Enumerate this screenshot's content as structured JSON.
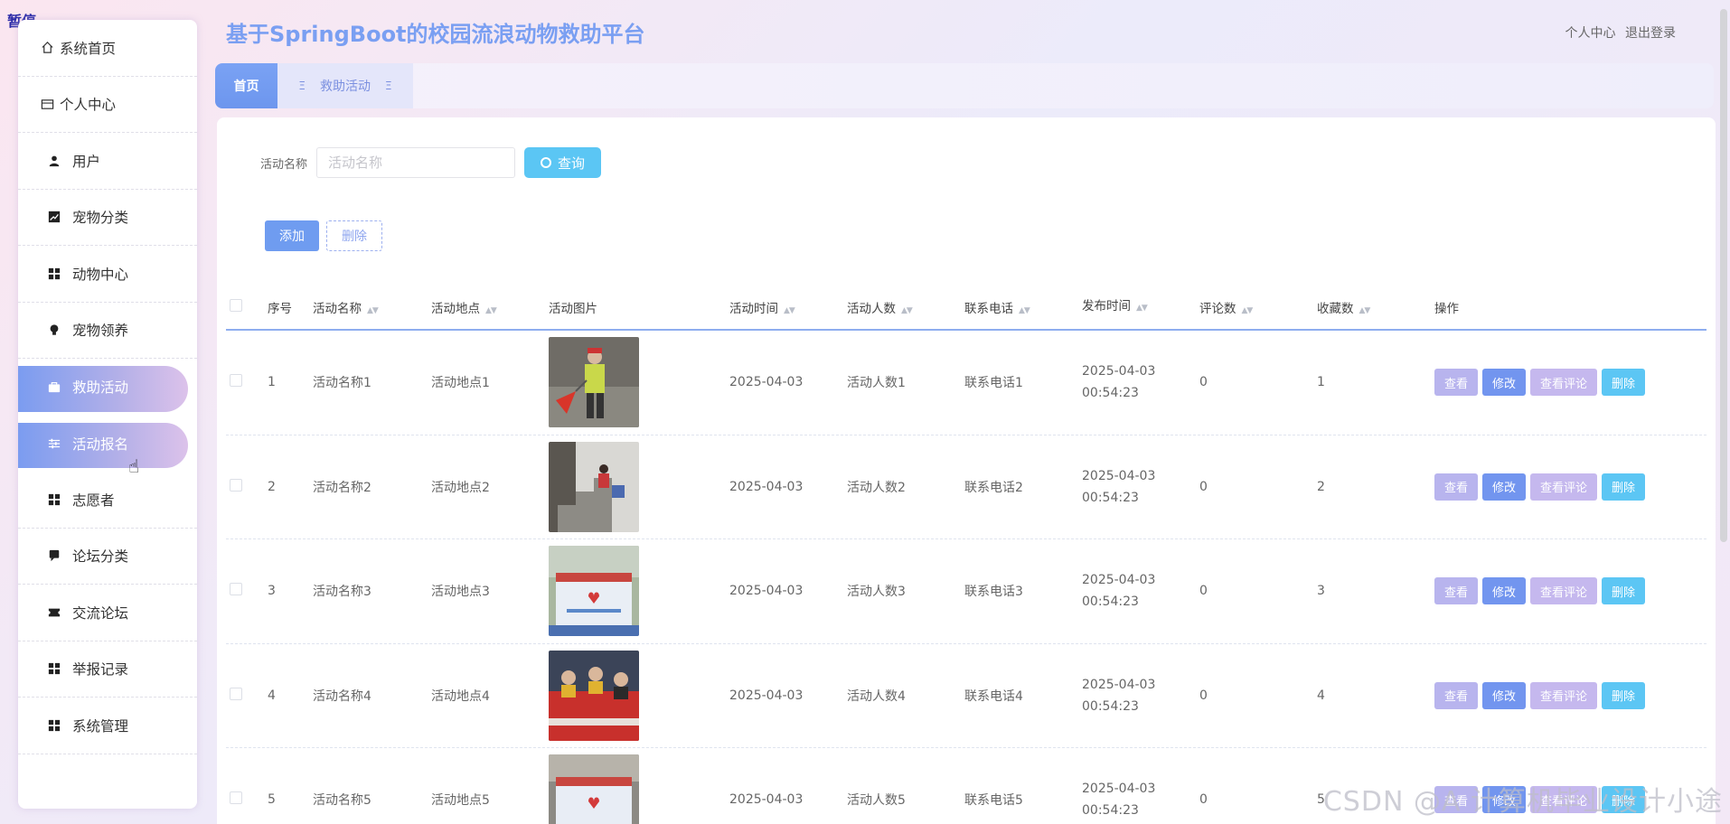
{
  "overlay": {
    "pause_tag": "暂停"
  },
  "header": {
    "title": "基于SpringBoot的校园流浪动物救助平台",
    "links": [
      "个人中心",
      "退出登录"
    ]
  },
  "sidebar": {
    "items": [
      {
        "label": "系统首页",
        "icon": "home-icon"
      },
      {
        "label": "个人中心",
        "icon": "card-icon"
      },
      {
        "label": "用户",
        "icon": "user-icon"
      },
      {
        "label": "宠物分类",
        "icon": "chart-icon"
      },
      {
        "label": "动物中心",
        "icon": "grid-icon"
      },
      {
        "label": "宠物领养",
        "icon": "bulb-icon"
      },
      {
        "label": "救助活动",
        "icon": "bag-icon",
        "active": true
      },
      {
        "label": "活动报名",
        "icon": "sliders-icon",
        "active": true
      },
      {
        "label": "志愿者",
        "icon": "grid-icon"
      },
      {
        "label": "论坛分类",
        "icon": "chat-icon"
      },
      {
        "label": "交流论坛",
        "icon": "ticket-icon"
      },
      {
        "label": "举报记录",
        "icon": "grid-icon"
      },
      {
        "label": "系统管理",
        "icon": "grid-icon"
      }
    ]
  },
  "tabs": {
    "home": "首页",
    "rescue": "救助活动",
    "separator": "Ξ"
  },
  "search": {
    "label": "活动名称",
    "placeholder": "活动名称",
    "button": "查询"
  },
  "actions": {
    "add": "添加",
    "delete": "删除"
  },
  "table": {
    "headers": [
      "序号",
      "活动名称",
      "活动地点",
      "活动图片",
      "活动时间",
      "活动人数",
      "联系电话",
      "发布时间",
      "评论数",
      "收藏数",
      "操作"
    ],
    "ops": {
      "view": "查看",
      "edit": "修改",
      "comments": "查看评论",
      "delete": "删除"
    },
    "rows": [
      {
        "idx": "1",
        "name": "活动名称1",
        "location": "活动地点1",
        "time": "2025-04-03",
        "people": "活动人数1",
        "phone": "联系电话1",
        "published": "2025-04-03 00:54:23",
        "comments": "0",
        "favorites": "1"
      },
      {
        "idx": "2",
        "name": "活动名称2",
        "location": "活动地点2",
        "time": "2025-04-03",
        "people": "活动人数2",
        "phone": "联系电话2",
        "published": "2025-04-03 00:54:23",
        "comments": "0",
        "favorites": "2"
      },
      {
        "idx": "3",
        "name": "活动名称3",
        "location": "活动地点3",
        "time": "2025-04-03",
        "people": "活动人数3",
        "phone": "联系电话3",
        "published": "2025-04-03 00:54:23",
        "comments": "0",
        "favorites": "3"
      },
      {
        "idx": "4",
        "name": "活动名称4",
        "location": "活动地点4",
        "time": "2025-04-03",
        "people": "活动人数4",
        "phone": "联系电话4",
        "published": "2025-04-03 00:54:23",
        "comments": "0",
        "favorites": "4"
      },
      {
        "idx": "5",
        "name": "活动名称5",
        "location": "活动地点5",
        "time": "2025-04-03",
        "people": "活动人数5",
        "phone": "联系电话5",
        "published": "2025-04-03 00:54:23",
        "comments": "0",
        "favorites": "5"
      }
    ]
  },
  "watermark": "CSDN @A 计算机毕业设计小途"
}
